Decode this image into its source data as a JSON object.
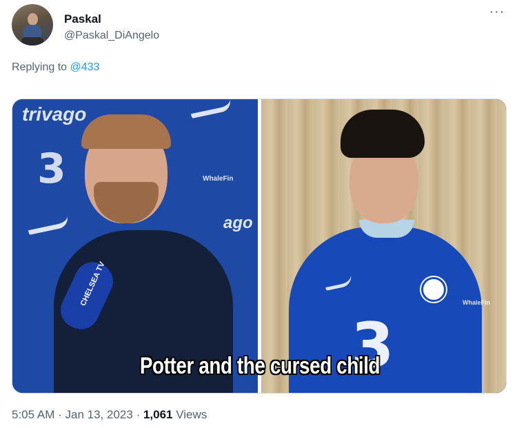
{
  "tweet": {
    "author_name": "Paskal",
    "author_handle": "@Paskal_DiAngelo",
    "more_icon": "more-horizontal-icon",
    "replying_prefix": "Replying to",
    "replying_to": "@433",
    "media": {
      "caption": "Potter and the cursed child",
      "left_brand": "trivago",
      "left_brand_partial": "ago",
      "left_sponsor": "WhaleFin",
      "left_number_logo": "3",
      "mic_label": "CHELSEA TV",
      "right_sponsor": "WhaleFin",
      "right_number_logo": "3"
    },
    "time": "5:05 AM",
    "separator": "·",
    "date": "Jan 13, 2023",
    "views_count": "1,061",
    "views_label": "Views"
  },
  "colors": {
    "link": "#1d9bf0",
    "secondary_text": "#536471",
    "primary_text": "#0f1419",
    "chelsea_blue": "#1849b8"
  }
}
